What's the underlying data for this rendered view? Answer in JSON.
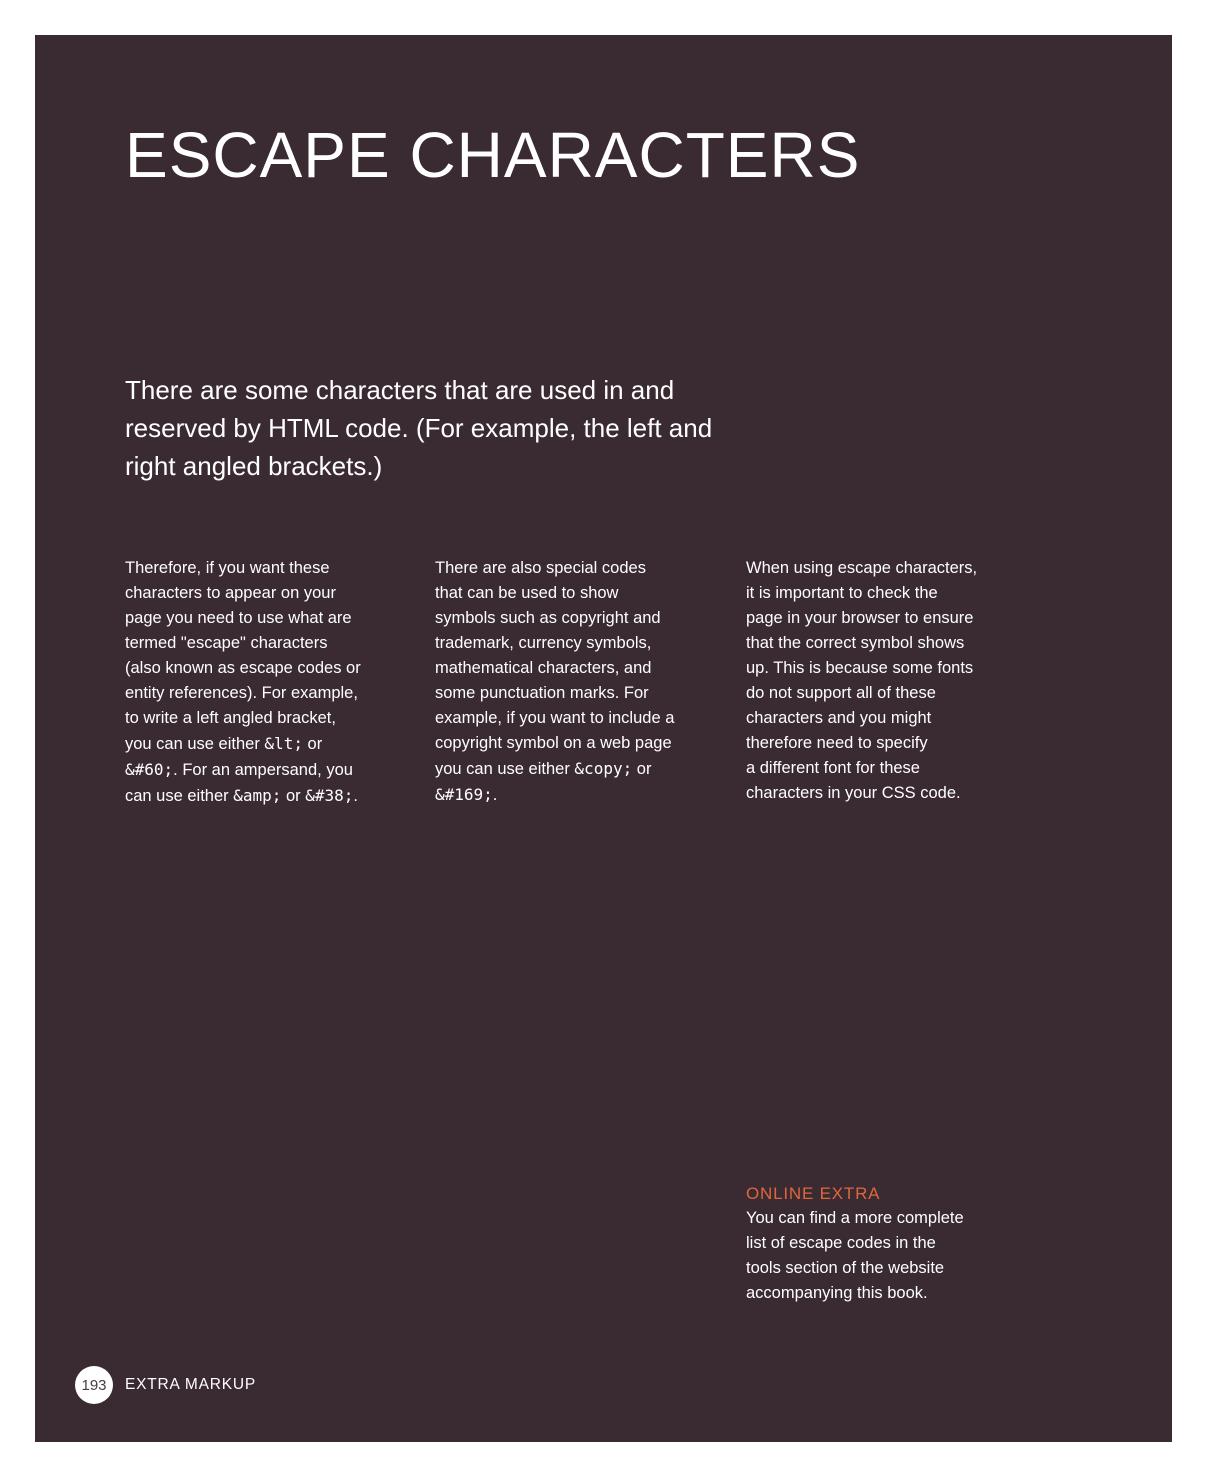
{
  "title": "ESCAPE CHARACTERS",
  "intro": "There are some characters that are used in and reserved by HTML code. (For example, the left and right angled brackets.)",
  "col1": {
    "l1": "Therefore, if you want these",
    "l2": "characters to appear on your",
    "l3": "page you need to use what are",
    "l4": "termed \"escape\" characters",
    "l5": "(also known as escape codes or",
    "l6": "entity references). For example,",
    "l7": "to write a left angled bracket,",
    "l8_pre": "you can use either ",
    "l8_code": "&lt;",
    "l8_post": " or",
    "l9_code": "&#60;",
    "l9_post": ". For an ampersand, you",
    "l10_pre": "can use either ",
    "l10_code1": "&amp;",
    "l10_mid": " or ",
    "l10_code2": "&#38;",
    "l10_post": "."
  },
  "col2": {
    "l1": "There are also special codes",
    "l2": "that can be used to show",
    "l3": "symbols such as copyright and",
    "l4": "trademark, currency symbols,",
    "l5": "mathematical characters, and",
    "l6": "some punctuation marks. For",
    "l7": "example, if you want to include a",
    "l8": "copyright symbol on a web page",
    "l9_pre": "you can use either ",
    "l9_code": "&copy;",
    "l9_post": " or",
    "l10_code": "&#169;",
    "l10_post": "."
  },
  "col3": {
    "l1": "When using escape characters,",
    "l2": "it is important to check the",
    "l3": "page in your browser to ensure",
    "l4": "that the correct symbol shows",
    "l5": "up. This is because some fonts",
    "l6": "do not support all of these",
    "l7": "characters and you might",
    "l8": "therefore need to specify",
    "l9": "a different font for these",
    "l10": "characters in your CSS code."
  },
  "online_extra": {
    "heading": "ONLINE EXTRA",
    "l1": "You can find a more complete",
    "l2": "list of escape codes in the",
    "l3": "tools section of the website",
    "l4": "accompanying this book."
  },
  "footer": {
    "page_number": "193",
    "section": "EXTRA MARKUP"
  },
  "colors": {
    "background": "#3a2a31",
    "text": "#ffffff",
    "accent": "#e0663e"
  }
}
